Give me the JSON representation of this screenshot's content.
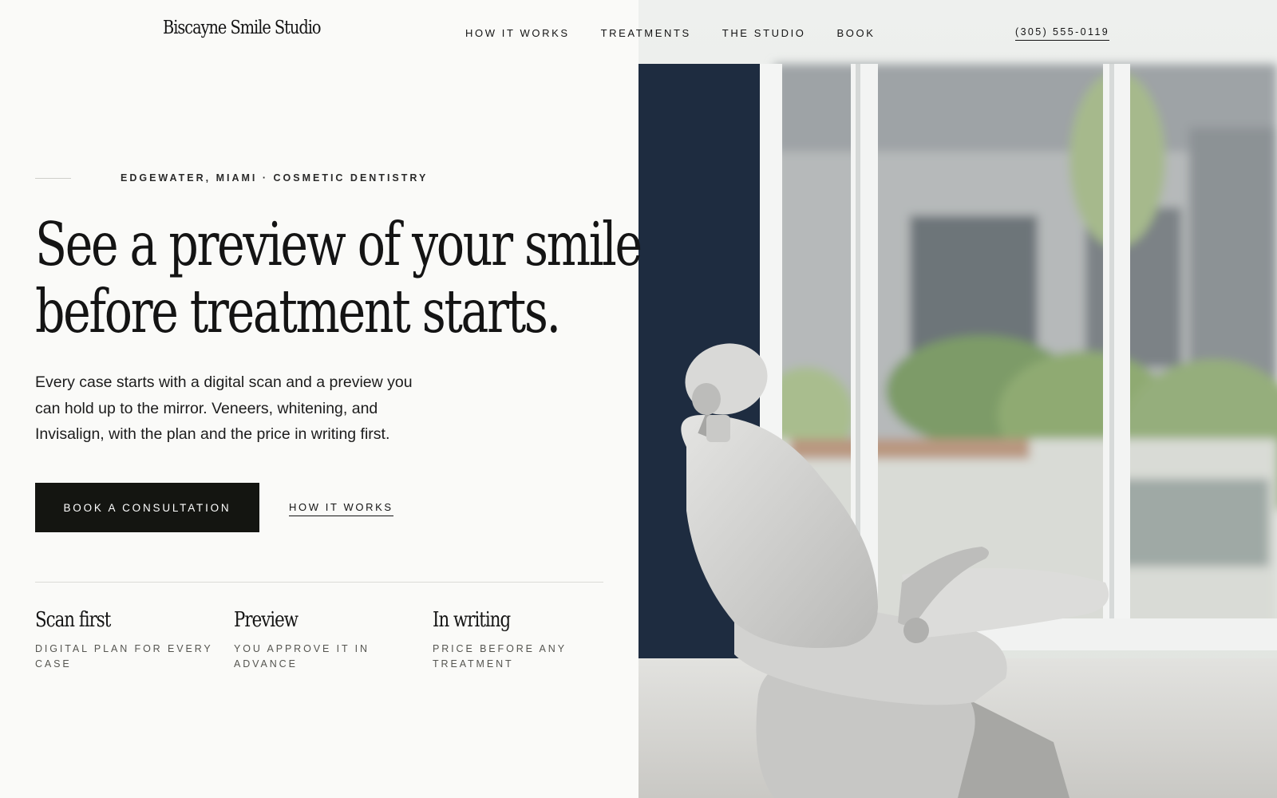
{
  "header": {
    "logo": "Biscayne Smile Studio",
    "nav": [
      {
        "label": "HOW IT WORKS"
      },
      {
        "label": "TREATMENTS"
      },
      {
        "label": "THE STUDIO"
      },
      {
        "label": "BOOK"
      }
    ],
    "phone": "(305) 555-0119"
  },
  "hero": {
    "eyebrow": "EDGEWATER, MIAMI · COSMETIC DENTISTRY",
    "headline_line1": "See a preview of your smile",
    "headline_line2": "before treatment starts.",
    "lede": "Every case starts with a digital scan and a preview you can hold up to the mirror. Veneers, whitening, and Invisalign, with the plan and the price in writing first.",
    "cta_primary": "BOOK A CONSULTATION",
    "cta_secondary": "HOW IT WORKS"
  },
  "features": [
    {
      "title": "Scan first",
      "desc": "DIGITAL PLAN FOR EVERY CASE"
    },
    {
      "title": "Preview",
      "desc": "YOU APPROVE IT IN ADVANCE"
    },
    {
      "title": "In writing",
      "desc": "PRICE BEFORE ANY TREATMENT"
    }
  ],
  "colors": {
    "background": "#fafaf8",
    "ink": "#141414",
    "button": "#141511",
    "navy_wall": "#1e2c40"
  },
  "photo": {
    "subject": "dental-chair-photo"
  }
}
